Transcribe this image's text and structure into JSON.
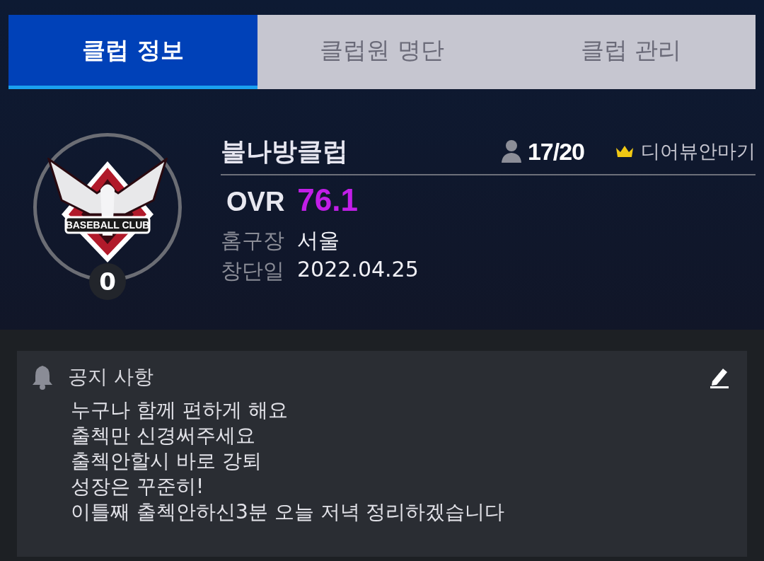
{
  "tabs": [
    {
      "label": "클럽 정보",
      "selected": true
    },
    {
      "label": "클럽원 명단",
      "selected": false
    },
    {
      "label": "클럽 관리",
      "selected": false
    }
  ],
  "club": {
    "logo_text": "BASEBALL CLUB",
    "level": "0",
    "name": "불나방클럽",
    "members": "17/20",
    "leader": "디어뷰안마기",
    "ovr_label": "OVR",
    "ovr": "76.1",
    "details": [
      {
        "label": "홈구장",
        "value": "서울"
      },
      {
        "label": "창단일",
        "value": "2022.04.25"
      }
    ]
  },
  "notice": {
    "title": "공지 사항",
    "lines": [
      "누구나 함께 편하게 해요",
      "출첵만 신경써주세요",
      "출첵안할시 바로 강퇴",
      "성장은 꾸준히!",
      "이틀째 출첵안하신3분 오늘 저녁 정리하겠습니다"
    ]
  }
}
